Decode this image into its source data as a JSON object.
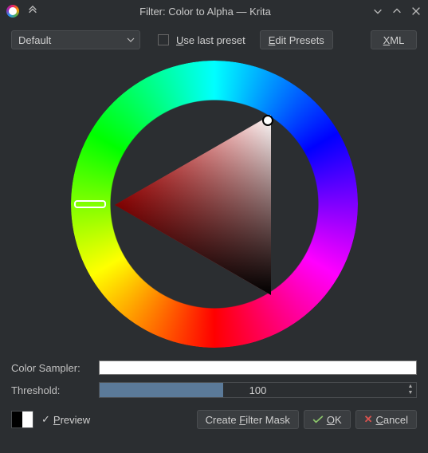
{
  "window": {
    "title": "Filter: Color to Alpha — Krita"
  },
  "toolbar": {
    "preset_selected": "Default",
    "use_last_preset_label": "Use last preset",
    "edit_presets_label": "Edit Presets",
    "xml_label": "XML"
  },
  "picker": {
    "hue_deg": 0,
    "selected_color": "#ffffff"
  },
  "fields": {
    "color_sampler_label": "Color Sampler:",
    "color_sampler_value": "#ffffff",
    "threshold_label": "Threshold:",
    "threshold_value": "100",
    "threshold_max": 255,
    "threshold_fill_pct": "39%"
  },
  "footer": {
    "preview_label": "Preview",
    "preview_checked": true,
    "create_mask_label": "Create Filter Mask",
    "ok_label": "OK",
    "cancel_label": "Cancel"
  }
}
